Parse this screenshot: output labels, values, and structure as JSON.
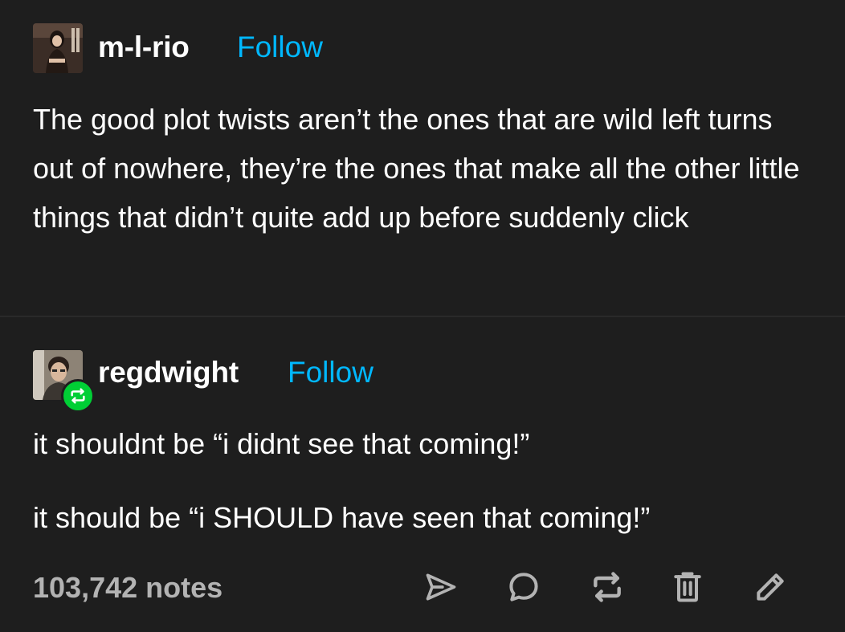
{
  "posts": [
    {
      "username": "m-l-rio",
      "follow_label": "Follow",
      "body": "The good plot twists aren’t the ones that are wild left turns out of nowhere, they’re the ones that make all the other little things that didn’t quite add up before suddenly click"
    },
    {
      "username": "regdwight",
      "follow_label": "Follow",
      "body_lines": [
        "it shouldnt be “i didnt see that coming!”",
        "it should be “i SHOULD have seen that coming!”"
      ]
    }
  ],
  "footer": {
    "notes": "103,742 notes",
    "actions": [
      "send-icon",
      "reply-icon",
      "reblog-icon",
      "delete-icon",
      "edit-icon"
    ]
  },
  "colors": {
    "background": "#1e1e1e",
    "text": "#ffffff",
    "follow": "#00b8ff",
    "muted": "#b3b3b3",
    "reblog_badge": "#00cf35"
  }
}
